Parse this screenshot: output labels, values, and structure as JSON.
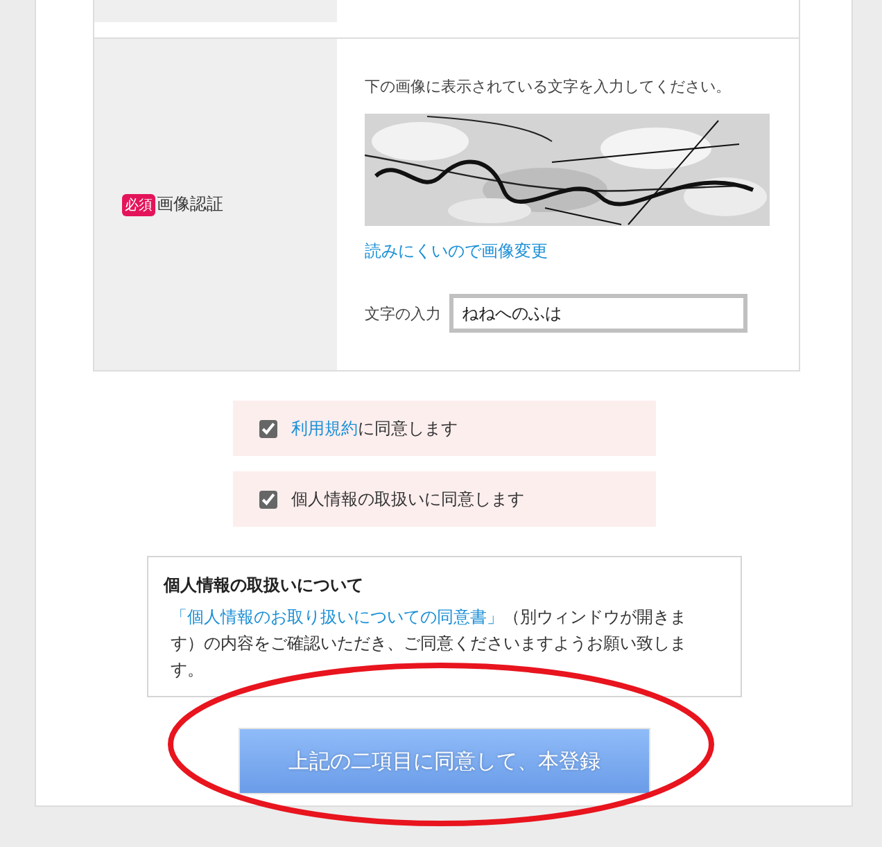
{
  "captcha_field": {
    "required_badge": "必須",
    "label": "画像認証",
    "instruction": "下の画像に表示されている文字を入力してください。",
    "refresh_link": "読みにくいので画像変更",
    "input_label": "文字の入力",
    "value": "ねねへのふは"
  },
  "agreements": [
    {
      "link": "利用規約",
      "text": "に同意します",
      "checked": true
    },
    {
      "text": "個人情報の取扱いに同意します",
      "checked": true
    }
  ],
  "privacy_notice": {
    "title": "個人情報の取扱いについて",
    "link": "「個人情報のお取り扱いについての同意書」",
    "text": "（別ウィンドウが開きます）の内容をご確認いただき、ご同意くださいますようお願い致します。"
  },
  "submit_button": "上記の二項目に同意して、本登録"
}
